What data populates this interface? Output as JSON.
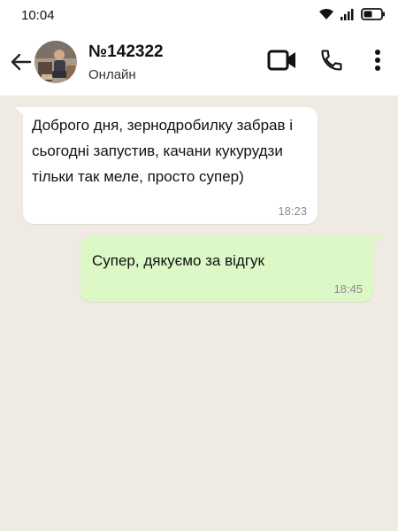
{
  "status_bar": {
    "time": "10:04",
    "icons": [
      "wifi-icon",
      "signal-icon",
      "battery-icon"
    ]
  },
  "header": {
    "contact_name": "№142322",
    "contact_status": "Онлайн",
    "icons": [
      "back-arrow-icon",
      "video-call-icon",
      "phone-icon",
      "more-vert-icon"
    ]
  },
  "messages": [
    {
      "direction": "incoming",
      "text": "Доброго дня, зернодробилку забрав і сьогодні запустив, качани кукурудзи тільки так меле, просто супер)",
      "time": "18:23"
    },
    {
      "direction": "outgoing",
      "text": "Супер, дякуємо за відгук",
      "time": "18:45"
    }
  ],
  "colors": {
    "chat_background": "#efeae2",
    "incoming_bubble": "#ffffff",
    "outgoing_bubble": "#dcf8c6",
    "timestamp": "#8c8c8c"
  }
}
